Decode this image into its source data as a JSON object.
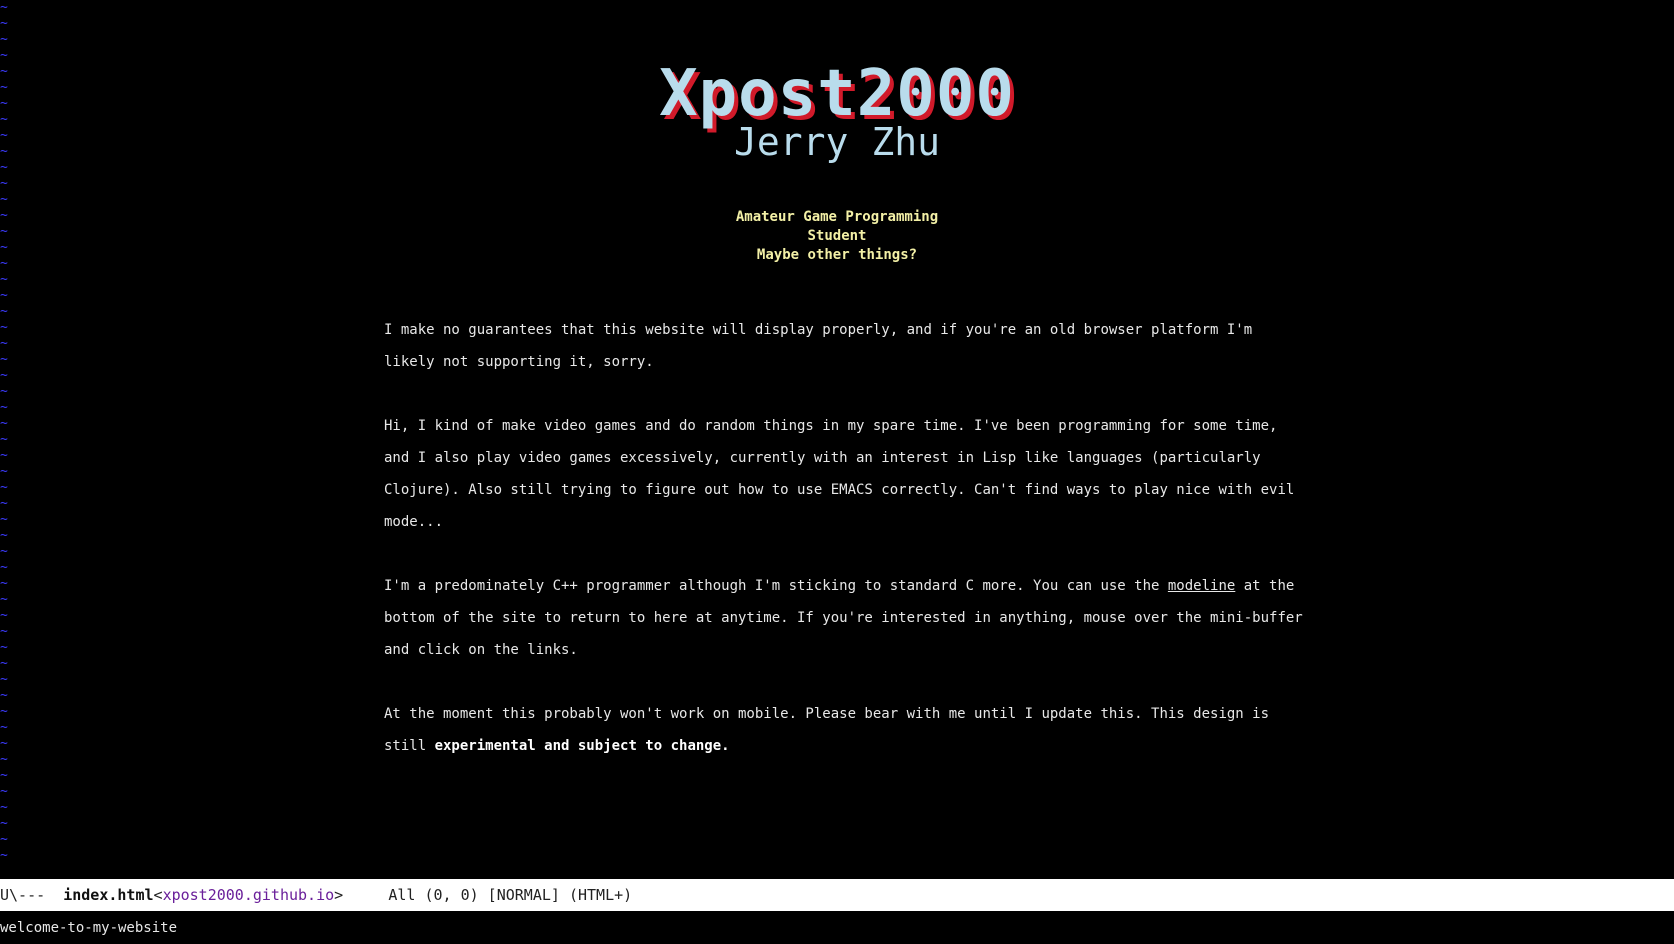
{
  "header": {
    "title": "Xpost2000",
    "subtitle": "Jerry Zhu"
  },
  "taglines": [
    "Amateur Game Programming",
    "Student",
    "Maybe other things?"
  ],
  "content": {
    "p1": "I make no guarantees that this website will display properly, and if you're an old browser platform I'm likely not supporting it, sorry.",
    "p2": "Hi, I kind of make video games and do random things in my spare time. I've been programming for some time, and I also play video games excessively, currently with an interest in Lisp like languages (particularly Clojure). Also still trying to figure out how to use EMACS correctly. Can't find ways to play nice with evil mode...",
    "p3_before": "I'm a predominately C++ programmer although I'm sticking to standard C more. You can use the ",
    "p3_link": "modeline",
    "p3_after": " at the bottom of the site to return to here at anytime. If you're interested in anything, mouse over the mini-buffer and click on the links.",
    "p4_before": "At the moment this probably won't work on mobile. Please bear with me until I update this. This design is still ",
    "p4_bold": "experimental and subject to change."
  },
  "gutter": {
    "glyph": "~"
  },
  "modeline": {
    "prefix": "U\\---  ",
    "buffer": "index.html",
    "host_open": "<",
    "host": "xpost2000.github.io",
    "host_close": ">",
    "status": "     All (0, 0) [NORMAL] (HTML+)"
  },
  "minibuffer": {
    "text": "welcome-to-my-website"
  },
  "colors": {
    "background": "#000000",
    "title": "#b9dcec",
    "title_shadow": "#d11a2a",
    "tagline": "#f3f0a6",
    "tilde": "#3b3bff",
    "modeline_bg": "#ffffff",
    "host": "#6a1f9a"
  }
}
